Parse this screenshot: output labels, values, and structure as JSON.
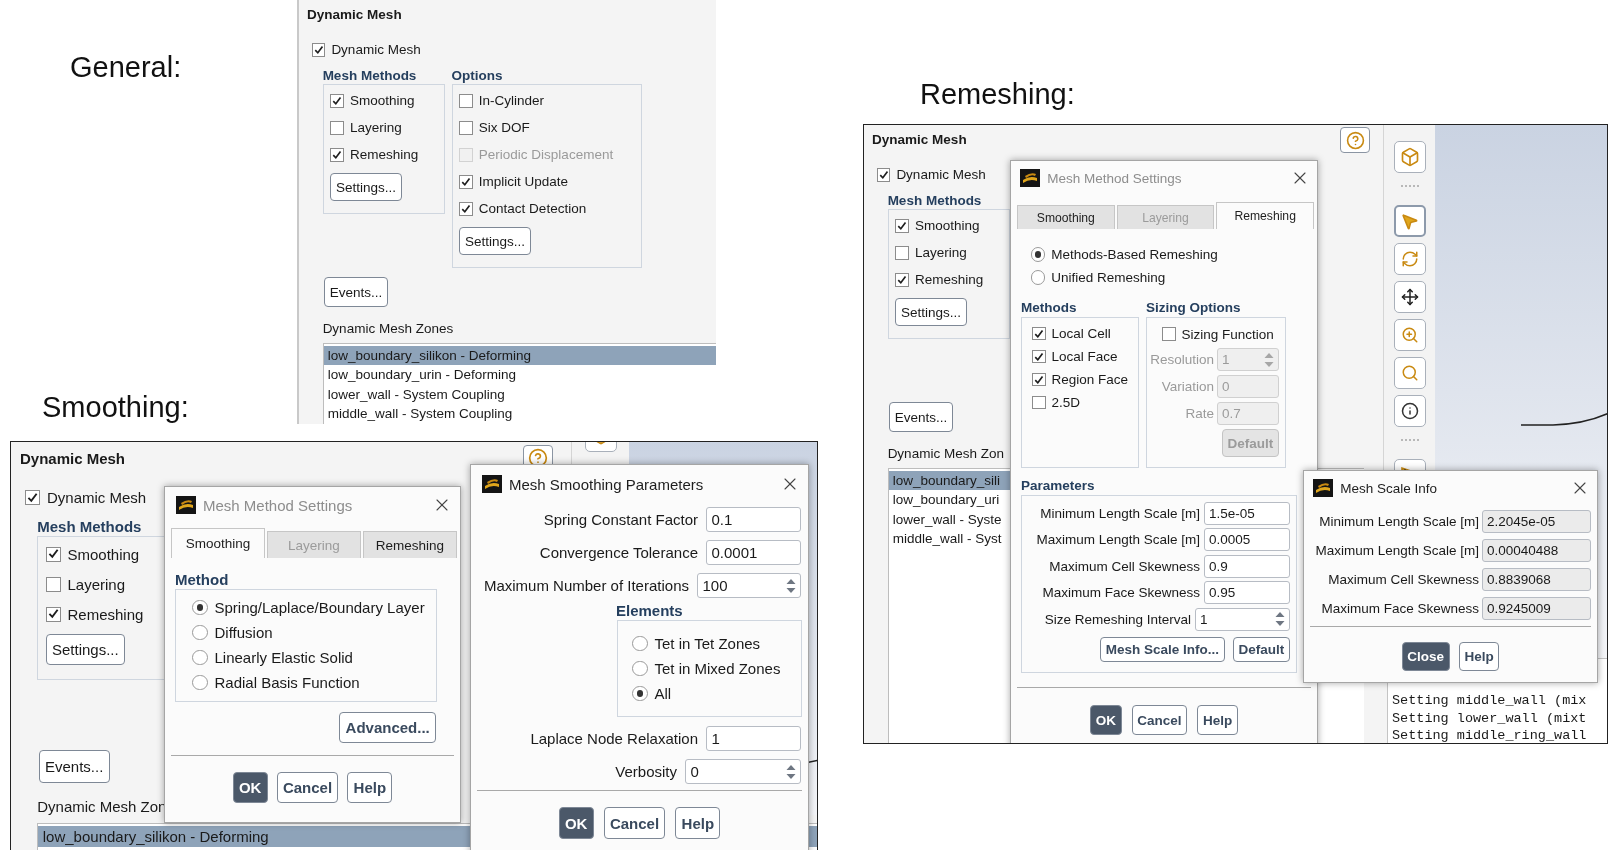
{
  "general": {
    "caption": "General:",
    "panel": {
      "title": "Dynamic Mesh",
      "enable": {
        "label": "Dynamic Mesh",
        "checked": true
      },
      "mesh_methods": {
        "title": "Mesh Methods",
        "items": [
          {
            "label": "Smoothing",
            "checked": true
          },
          {
            "label": "Layering",
            "checked": false
          },
          {
            "label": "Remeshing",
            "checked": true
          }
        ],
        "button": "Settings..."
      },
      "options": {
        "title": "Options",
        "items": [
          {
            "label": "In-Cylinder",
            "checked": false,
            "disabled": false
          },
          {
            "label": "Six DOF",
            "checked": false,
            "disabled": false
          },
          {
            "label": "Periodic Displacement",
            "checked": false,
            "disabled": true
          },
          {
            "label": "Implicit Update",
            "checked": true,
            "disabled": false
          },
          {
            "label": "Contact Detection",
            "checked": true,
            "disabled": false
          }
        ],
        "button": "Settings..."
      },
      "events_button": "Events...",
      "zones": {
        "title": "Dynamic Mesh Zones",
        "items": [
          {
            "label": "low_boundary_silikon - Deforming",
            "selected": true
          },
          {
            "label": "low_boundary_urin - Deforming",
            "selected": false
          },
          {
            "label": "lower_wall - System Coupling",
            "selected": false
          },
          {
            "label": "middle_wall - System Coupling",
            "selected": false
          }
        ]
      }
    }
  },
  "smoothing": {
    "caption": "Smoothing:",
    "panel": {
      "title": "Dynamic Mesh",
      "enable": {
        "label": "Dynamic Mesh",
        "checked": true
      },
      "mesh_methods": {
        "title": "Mesh Methods",
        "items": [
          {
            "label": "Smoothing",
            "checked": true
          },
          {
            "label": "Layering",
            "checked": false
          },
          {
            "label": "Remeshing",
            "checked": true
          }
        ],
        "button": "Settings..."
      },
      "events_button": "Events...",
      "zones": {
        "title": "Dynamic Mesh Zon",
        "items": [
          {
            "label": "low_boundary_silikon - Deforming",
            "selected": true
          }
        ]
      }
    },
    "method_dialog": {
      "title": "Mesh Method Settings",
      "active": false,
      "tabs": [
        {
          "label": "Smoothing",
          "selected": true,
          "disabled": false
        },
        {
          "label": "Layering",
          "selected": false,
          "disabled": true
        },
        {
          "label": "Remeshing",
          "selected": false,
          "disabled": false
        }
      ],
      "group_title": "Method",
      "options": [
        {
          "label": "Spring/Laplace/Boundary Layer",
          "selected": true
        },
        {
          "label": "Diffusion",
          "selected": false
        },
        {
          "label": "Linearly Elastic Solid",
          "selected": false
        },
        {
          "label": "Radial Basis Function",
          "selected": false
        }
      ],
      "advanced_button": "Advanced...",
      "buttons": [
        {
          "label": "OK",
          "primary": true
        },
        {
          "label": "Cancel",
          "primary": false
        },
        {
          "label": "Help",
          "primary": false
        }
      ]
    },
    "params_dialog": {
      "title": "Mesh Smoothing Parameters",
      "active": true,
      "rows": [
        {
          "kind": "text",
          "label": "Spring Constant Factor",
          "value": "0.1"
        },
        {
          "kind": "text",
          "label": "Convergence Tolerance",
          "value": "0.0001"
        },
        {
          "kind": "spin",
          "label": "Maximum Number of Iterations",
          "value": "100"
        },
        {
          "kind": "group",
          "title": "Elements",
          "options": [
            {
              "label": "Tet in Tet Zones",
              "selected": false
            },
            {
              "label": "Tet in Mixed Zones",
              "selected": false
            },
            {
              "label": "All",
              "selected": true
            }
          ]
        },
        {
          "kind": "text",
          "label": "Laplace Node Relaxation",
          "value": "1"
        },
        {
          "kind": "spin",
          "label": "Verbosity",
          "value": "0"
        }
      ],
      "buttons": [
        {
          "label": "OK",
          "primary": true
        },
        {
          "label": "Cancel",
          "primary": false
        },
        {
          "label": "Help",
          "primary": false
        }
      ]
    }
  },
  "remeshing": {
    "caption": "Remeshing:",
    "panel": {
      "title": "Dynamic Mesh",
      "enable": {
        "label": "Dynamic Mesh",
        "checked": true
      },
      "mesh_methods": {
        "title": "Mesh Methods",
        "items": [
          {
            "label": "Smoothing",
            "checked": true
          },
          {
            "label": "Layering",
            "checked": false
          },
          {
            "label": "Remeshing",
            "checked": true
          }
        ],
        "button": "Settings..."
      },
      "events_button": "Events...",
      "zones": {
        "title": "Dynamic Mesh Zon",
        "items": [
          {
            "label": "low_boundary_sili",
            "selected": true
          },
          {
            "label": "low_boundary_uri",
            "selected": false
          },
          {
            "label": "lower_wall - Syste",
            "selected": false
          },
          {
            "label": "middle_wall - Syst",
            "selected": false
          }
        ]
      }
    },
    "method_dialog": {
      "title": "Mesh Method Settings",
      "active": false,
      "tabs": [
        {
          "label": "Smoothing",
          "selected": false,
          "disabled": false
        },
        {
          "label": "Layering",
          "selected": false,
          "disabled": true
        },
        {
          "label": "Remeshing",
          "selected": true,
          "disabled": false
        }
      ],
      "modes": [
        {
          "label": "Methods-Based Remeshing",
          "selected": true
        },
        {
          "label": "Unified Remeshing",
          "selected": false
        }
      ],
      "methods": {
        "title": "Methods",
        "items": [
          {
            "label": "Local Cell",
            "checked": true
          },
          {
            "label": "Local Face",
            "checked": true
          },
          {
            "label": "Region Face",
            "checked": true
          },
          {
            "label": "2.5D",
            "checked": false
          }
        ]
      },
      "sizing": {
        "title": "Sizing Options",
        "function": {
          "label": "Sizing Function",
          "checked": false
        },
        "fields": [
          {
            "kind": "spin",
            "label": "Resolution",
            "value": "1",
            "disabled": true
          },
          {
            "kind": "text",
            "label": "Variation",
            "value": "0",
            "disabled": true
          },
          {
            "kind": "text",
            "label": "Rate",
            "value": "0.7",
            "disabled": true
          }
        ],
        "button": {
          "label": "Default",
          "disabled": true
        }
      },
      "parameters": {
        "title": "Parameters",
        "fields": [
          {
            "kind": "text",
            "label": "Minimum Length Scale [m]",
            "value": "1.5e-05"
          },
          {
            "kind": "text",
            "label": "Maximum Length Scale [m]",
            "value": "0.0005"
          },
          {
            "kind": "text",
            "label": "Maximum Cell Skewness",
            "value": "0.9"
          },
          {
            "kind": "text",
            "label": "Maximum Face Skewness",
            "value": "0.95"
          },
          {
            "kind": "spin",
            "label": "Size Remeshing Interval",
            "value": "1"
          }
        ],
        "buttons": [
          "Mesh Scale Info...",
          "Default"
        ]
      },
      "buttons": [
        {
          "label": "OK",
          "primary": true
        },
        {
          "label": "Cancel",
          "primary": false
        },
        {
          "label": "Help",
          "primary": false
        }
      ]
    },
    "scale_dialog": {
      "title": "Mesh Scale Info",
      "active": true,
      "fields": [
        {
          "kind": "readonly",
          "label": "Minimum Length Scale [m]",
          "value": "2.2045e-05"
        },
        {
          "kind": "readonly",
          "label": "Maximum Length Scale [m]",
          "value": "0.00040488"
        },
        {
          "kind": "readonly",
          "label": "Maximum Cell Skewness",
          "value": "0.8839068"
        },
        {
          "kind": "readonly",
          "label": "Maximum Face Skewness",
          "value": "0.9245009"
        }
      ],
      "buttons": [
        {
          "label": "Close",
          "primary": true
        },
        {
          "label": "Help",
          "primary": false
        }
      ]
    },
    "console": [
      "Setting middle_wall (mix",
      "Setting lower_wall (mixt",
      "Setting middle_ring_wall"
    ]
  }
}
